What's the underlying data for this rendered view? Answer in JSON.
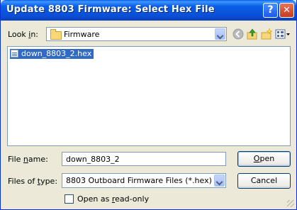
{
  "window": {
    "title": "Update 8803 Firmware: Select Hex File",
    "help_glyph": "?",
    "close_glyph": "✕"
  },
  "look_in": {
    "label_prefix": "Look ",
    "label_accel": "i",
    "label_suffix": "n:",
    "value": "Firmware",
    "icon": "folder-icon"
  },
  "toolbar": {
    "buttons": [
      {
        "name": "back-button",
        "icon": "back-arrow-icon"
      },
      {
        "name": "up-folder-button",
        "icon": "up-folder-icon"
      },
      {
        "name": "new-folder-button",
        "icon": "new-folder-icon"
      },
      {
        "name": "view-menu-button",
        "icon": "view-menu-icon"
      }
    ]
  },
  "file_list": {
    "items": [
      {
        "name": "down_8803_2.hex",
        "selected": true,
        "icon": "hex-file-icon"
      }
    ]
  },
  "file_name": {
    "label_prefix": "File ",
    "label_accel": "n",
    "label_suffix": "ame:",
    "value": "down_8803_2"
  },
  "file_type": {
    "label_prefix": "Files of ",
    "label_accel": "t",
    "label_suffix": "ype:",
    "value": "8803 Outboard Firmware Files (*.hex)"
  },
  "buttons": {
    "open_accel": "O",
    "open_rest": "pen",
    "cancel": "Cancel"
  },
  "read_only": {
    "prefix": "Open as ",
    "accel": "r",
    "suffix": "ead-only",
    "checked": false
  },
  "colors": {
    "title_bar": "#0A5FE6",
    "selection": "#316AC5",
    "dialog_bg": "#ECE9D8"
  }
}
